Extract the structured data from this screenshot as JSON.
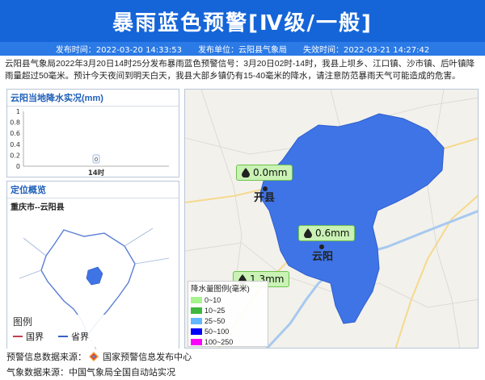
{
  "header": {
    "title": "暴雨蓝色预警[Ⅳ级/一般]",
    "publish_time": "发布时间：2022-03-20 14:33:53",
    "publish_unit": "发布单位：云阳县气象局",
    "expire_time": "失效时间：2022-03-21 14:27:42"
  },
  "description": "云阳县气象局2022年3月20日14时25分发布暴雨蓝色预警信号：3月20日02时-14时，我县上坝乡、江口镇、沙市镇、后叶镇降雨量超过50毫米。预计今天夜间到明天白天，我县大部乡镇仍有15-40毫米的降水，请注意防范暴雨天气可能造成的危害。",
  "rain_panel": {
    "title": "云阳当地降水实况(mm)"
  },
  "chart_data": {
    "type": "bar",
    "categories": [
      "14时"
    ],
    "values": [
      0
    ],
    "data_labels": [
      "0"
    ],
    "yticks": [
      "1",
      "0.8",
      "0.6",
      "0.4",
      "0.2",
      "0"
    ],
    "ylim": [
      0,
      1
    ],
    "grid": false
  },
  "location_panel": {
    "title": "定位概览",
    "subtitle": "重庆市--云阳县",
    "legend_title": "图例",
    "legend_items": [
      {
        "label": "国界",
        "color": "#c0404c"
      },
      {
        "label": "省界",
        "color": "#3a5fcd"
      }
    ]
  },
  "map": {
    "region_color": "#3f74e6",
    "labels": [
      {
        "name": "开县",
        "rain": "0.0mm"
      },
      {
        "name": "云阳",
        "rain": "0.6mm"
      }
    ],
    "extra_bubble": "1.3mm",
    "rain_legend": {
      "title": "降水量图例(毫米)",
      "items": [
        {
          "label": "0~10",
          "color": "#a6f28f"
        },
        {
          "label": "10~25",
          "color": "#3db83d"
        },
        {
          "label": "25~50",
          "color": "#61b8ff"
        },
        {
          "label": "50~100",
          "color": "#0000fe"
        },
        {
          "label": "100~250",
          "color": "#fa00fa"
        }
      ]
    }
  },
  "footer": {
    "warning_source": "预警信息数据来源：",
    "warning_source_name": "国家预警信息发布中心",
    "weather_source": "气象数据来源：中国气象局全国自动站实况"
  }
}
